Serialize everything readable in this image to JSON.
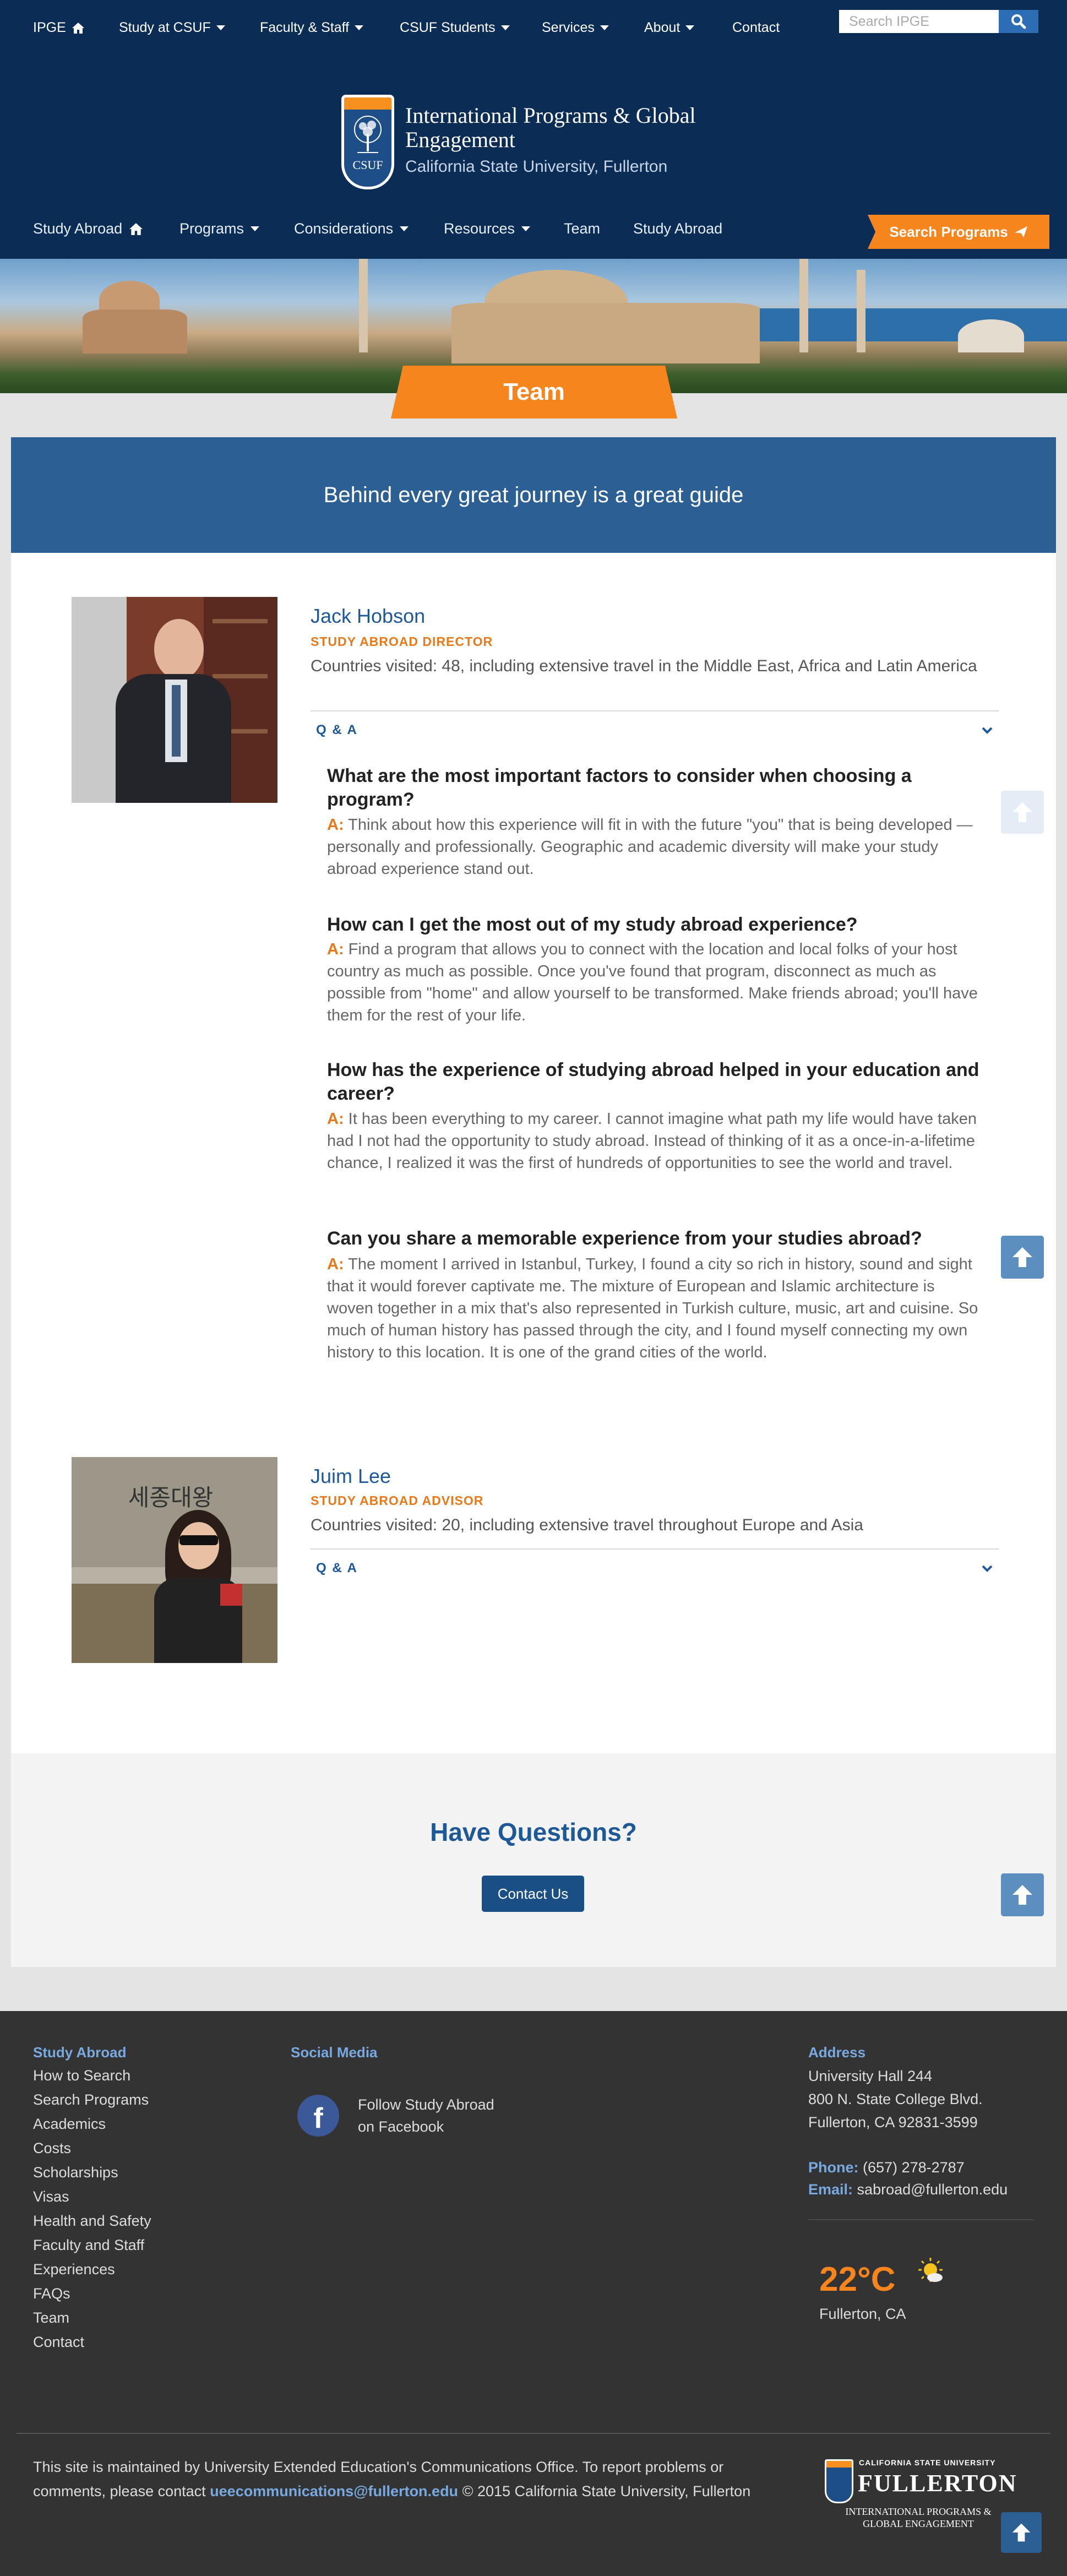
{
  "topnav": {
    "items": [
      {
        "label": "IPGE"
      },
      {
        "label": "Study at CSUF"
      },
      {
        "label": "Faculty & Staff"
      },
      {
        "label": "CSUF Students"
      },
      {
        "label": "Services"
      },
      {
        "label": "About"
      },
      {
        "label": "Contact"
      }
    ],
    "search_placeholder": "Search IPGE"
  },
  "header": {
    "logo_text": "CSUF",
    "title": "International Programs & Global Engagement",
    "subtitle": "California State University, Fullerton",
    "subnav": [
      {
        "label": "Study Abroad"
      },
      {
        "label": "Programs"
      },
      {
        "label": "Considerations"
      },
      {
        "label": "Resources"
      },
      {
        "label": "Team"
      },
      {
        "label": "Study Abroad"
      }
    ],
    "search_programs_label": "Search Programs"
  },
  "banner": {
    "ribbon_label": "Team"
  },
  "tagline": "Behind every great journey is a great guide",
  "team": [
    {
      "name": "Jack Hobson",
      "role": "STUDY ABROAD DIRECTOR",
      "countries": "Countries visited: 48, including extensive travel in the Middle East, Africa and Latin America",
      "qa_label": "Q & A",
      "answer_label": "A:",
      "qa": [
        {
          "q": "What are the most important factors to consider when choosing a program?",
          "a": "Think about how this experience will fit in with the future \"you\" that is being developed — personally and professionally. Geographic and academic diversity will make your study abroad experience stand out."
        },
        {
          "q": "How can I get the most out of my study abroad experience?",
          "a": "Find a program that allows you to connect with the location and local folks of your host country as much as possible. Once you've found that program, disconnect as much as possible from \"home\" and allow yourself to be transformed. Make friends abroad; you'll have them for the rest of your life."
        },
        {
          "q": "How has the experience of studying abroad helped in your education and career?",
          "a": "It has been everything to my career. I cannot imagine what path my life would have taken had I not had the opportunity to study abroad. Instead of thinking of it as a once-in-a-lifetime chance, I realized it was the first of hundreds of opportunities to see the world and travel."
        },
        {
          "q": "Can you share a memorable experience from your studies abroad?",
          "a": "The moment I arrived in Istanbul, Turkey, I found a city so rich in history, sound and sight that it would forever captivate me. The mixture of European and Islamic architecture is woven together in a mix that's also represented in Turkish culture, music, art and cuisine. So much of human history has passed through the city, and I found myself connecting my own history to this location. It is one of the grand cities of the world."
        }
      ]
    },
    {
      "name": "Juim Lee",
      "role": "STUDY ABROAD ADVISOR",
      "countries": "Countries visited: 20, including extensive travel throughout Europe and Asia",
      "qa_label": "Q & A",
      "photo_sign_text": "세종대왕"
    }
  ],
  "questions": {
    "title": "Have Questions?",
    "button": "Contact Us"
  },
  "footer": {
    "study_abroad": {
      "title": "Study Abroad",
      "links": [
        "How to Search",
        "Search Programs",
        "Academics",
        "Costs",
        "Scholarships",
        "Visas",
        "Health and Safety",
        "Faculty and Staff",
        "Experiences",
        "FAQs",
        "Team",
        "Contact"
      ]
    },
    "social": {
      "title": "Social Media",
      "facebook_text_1": "Follow Study Abroad",
      "facebook_text_2": "on Facebook"
    },
    "address": {
      "title": "Address",
      "line1": "University Hall 244",
      "line2": "800 N. State College Blvd.",
      "line3": "Fullerton, CA 92831-3599",
      "phone_label": "Phone:",
      "phone": "(657) 278-2787",
      "email_label": "Email:",
      "email": "sabroad@fullerton.edu"
    },
    "weather": {
      "temp": "22°C",
      "location": "Fullerton, CA",
      "icon": "partly-sunny-icon"
    },
    "bottom": {
      "text1": "This site is maintained by University Extended Education's Communications Office. To report problems or comments, please contact",
      "email": "ueecommunications@fullerton.edu",
      "text2": "© 2015 California State University, Fullerton"
    },
    "logo": {
      "line1": "CALIFORNIA STATE UNIVERSITY",
      "line2": "FULLERTON",
      "line3": "INTERNATIONAL PROGRAMS & GLOBAL ENGAGEMENT"
    }
  },
  "colors": {
    "navy": "#0b2d55",
    "orange": "#f7851d",
    "blue": "#1e5897",
    "tagline_bg": "#2c5f93",
    "footer_bg": "#333333"
  }
}
